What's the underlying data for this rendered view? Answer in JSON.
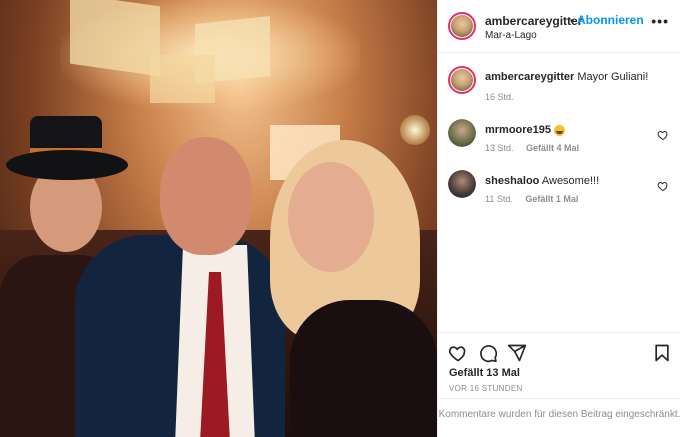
{
  "post": {
    "username": "ambercareygitter",
    "separator": "•",
    "follow_label": "Abonnieren",
    "location": "Mar-a-Lago",
    "more_icon": "more-icon"
  },
  "caption": {
    "username": "ambercareygitter",
    "text": "Mayor Guliani!",
    "time": "16 Std."
  },
  "comments": [
    {
      "username": "mrmoore195",
      "text": "",
      "emoji": "grinning-face-emoji",
      "time": "13 Std.",
      "likes": "Gefällt 4 Mal"
    },
    {
      "username": "sheshaloo",
      "text": "Awesome!!!",
      "time": "11 Std.",
      "likes": "Gefällt 1 Mal"
    }
  ],
  "actions": [
    "heart-icon",
    "comment-icon",
    "share-icon",
    "bookmark-icon"
  ],
  "likes_total": "Gefällt 13 Mal",
  "posted": "VOR 16 STUNDEN",
  "comments_closed": "Kommentare wurden für diesen Beitrag eingeschränkt.",
  "colors": {
    "link": "#0095f6",
    "muted": "#8e8e8e",
    "text": "#262626"
  }
}
